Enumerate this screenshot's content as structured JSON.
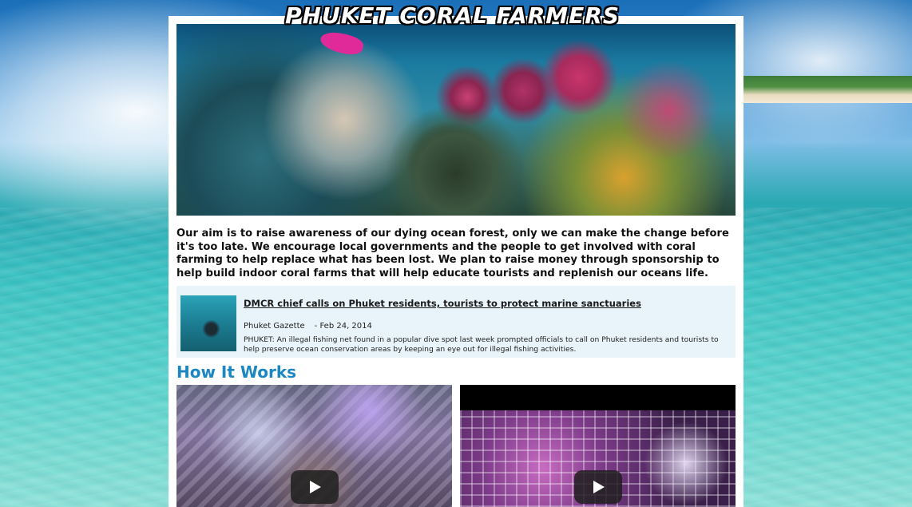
{
  "site": {
    "logo_text": "PHUKET CORAL FARMERS"
  },
  "intro": {
    "text": "Our aim is to raise awareness of our dying ocean forest, only we can make the change before it's too late. We encourage local governments and the people to get involved with coral farming to help replace what has been lost. We plan to raise money through sponsorship to help build indoor coral farms that will help educate tourists and replenish our oceans life."
  },
  "news": {
    "title": "DMCR chief calls on Phuket residents, tourists to protect marine sanctuaries",
    "source": "Phuket Gazette",
    "date": "- Feb 24, 2014",
    "summary": "PHUKET: An illegal fishing net found in a popular dive spot last week prompted officials to call on Phuket residents and tourists to help preserve ocean conservation areas by keeping an eye out for illegal fishing activities."
  },
  "how_it_works": {
    "title": "How It Works",
    "videos": [
      {
        "icon": "play-icon"
      },
      {
        "icon": "play-icon"
      }
    ]
  },
  "colors": {
    "accent": "#1a87c2",
    "news_bg": "#e8f4fa",
    "panel_bg": "#ffffff"
  }
}
